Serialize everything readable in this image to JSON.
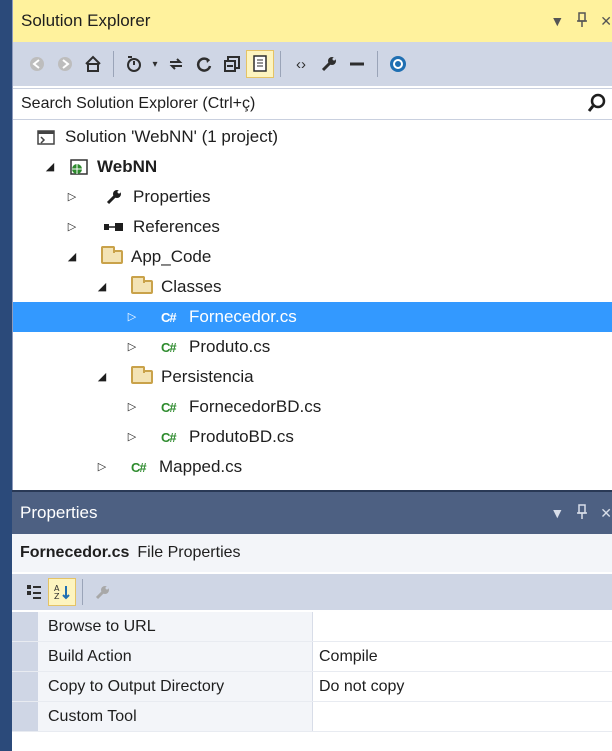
{
  "solution_explorer": {
    "title": "Solution Explorer",
    "search_placeholder": "Search Solution Explorer (Ctrl+ç)",
    "toolbar_icons": [
      "back-icon",
      "forward-icon",
      "home-icon",
      "pending-changes-icon",
      "sync-icon",
      "refresh-icon",
      "collapse-all-icon",
      "show-all-files-icon",
      "view-code-icon",
      "properties-icon",
      "preview-icon",
      "git-icon"
    ],
    "tree": [
      {
        "label": "Solution 'WebNN' (1 project)",
        "icon": "solution-icon",
        "expander": ""
      },
      {
        "label": "WebNN",
        "icon": "web-project-icon",
        "expander": "expanded",
        "bold": true
      },
      {
        "label": "Properties",
        "icon": "wrench-icon",
        "expander": "collapsed"
      },
      {
        "label": "References",
        "icon": "references-icon",
        "expander": "collapsed"
      },
      {
        "label": "App_Code",
        "icon": "folder-icon",
        "expander": "expanded"
      },
      {
        "label": "Classes",
        "icon": "folder-icon",
        "expander": "expanded"
      },
      {
        "label": "Fornecedor.cs",
        "icon": "csharp-file-icon",
        "expander": "collapsed",
        "selected": true
      },
      {
        "label": "Produto.cs",
        "icon": "csharp-file-icon",
        "expander": "collapsed"
      },
      {
        "label": "Persistencia",
        "icon": "folder-icon",
        "expander": "expanded"
      },
      {
        "label": "FornecedorBD.cs",
        "icon": "csharp-file-icon",
        "expander": "collapsed"
      },
      {
        "label": "ProdutoBD.cs",
        "icon": "csharp-file-icon",
        "expander": "collapsed"
      },
      {
        "label": "Mapped.cs",
        "icon": "csharp-file-icon",
        "expander": "collapsed"
      }
    ],
    "csharp_glyph": "C#"
  },
  "properties": {
    "title": "Properties",
    "object_name": "Fornecedor.cs",
    "object_type": "File Properties",
    "rows": [
      {
        "name": "Browse to URL",
        "value": ""
      },
      {
        "name": "Build Action",
        "value": "Compile"
      },
      {
        "name": "Copy to Output Directory",
        "value": "Do not copy"
      },
      {
        "name": "Custom Tool",
        "value": ""
      }
    ]
  },
  "colors": {
    "title_active": "#fff29d",
    "title_inactive": "#4d6082",
    "selection": "#3399ff",
    "toolbar": "#cfd6e5"
  }
}
